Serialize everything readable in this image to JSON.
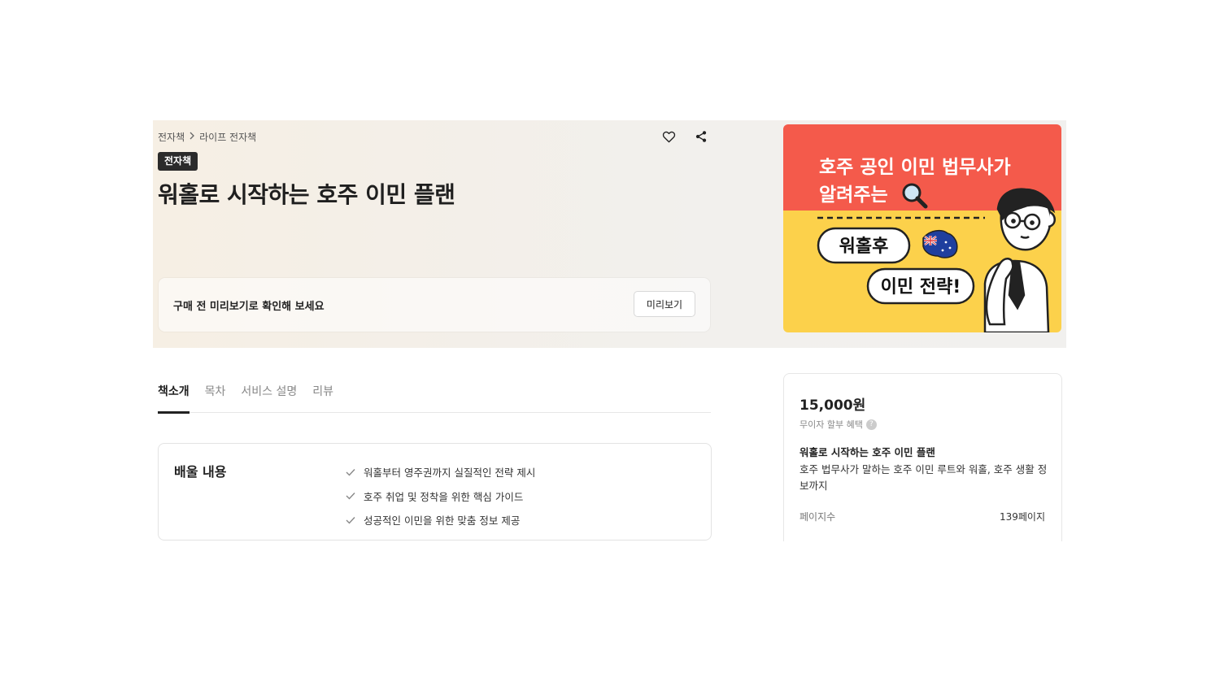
{
  "breadcrumb": {
    "items": [
      "전자책",
      "라이프 전자책"
    ]
  },
  "header_icons": {
    "like": "heart-icon",
    "share": "share-icon"
  },
  "badge": "전자책",
  "title": "워홀로 시작하는 호주 이민 플랜",
  "preview": {
    "text": "구매 전 미리보기로 확인해 보세요",
    "button": "미리보기"
  },
  "cover": {
    "line1": "호주 공인 이민 법무사가",
    "line2": "알려주는",
    "pill1": "워홀후",
    "pill2": "이민 전략!",
    "colors": {
      "top": "#f45a4b",
      "bottom": "#fcd14b"
    }
  },
  "tabs": [
    "책소개",
    "목차",
    "서비스 설명",
    "리뷰"
  ],
  "delivery": {
    "heading": "배울 내용",
    "items": [
      "워홀부터 영주권까지 실질적인 전략 제시",
      "호주 취업 및 정착을 위한 핵심 가이드",
      "성공적인 이민을 위한 맞춤 정보 제공"
    ]
  },
  "purchase": {
    "price": "15,000원",
    "installment": "무이자 할부 혜택",
    "book_title": "워홀로 시작하는 호주 이민 플랜",
    "description": "호주 법무사가 말하는 호주 이민 루트와 워홀, 호주 생활 정보까지",
    "pages_label": "페이지수",
    "pages_value": "139페이지"
  }
}
